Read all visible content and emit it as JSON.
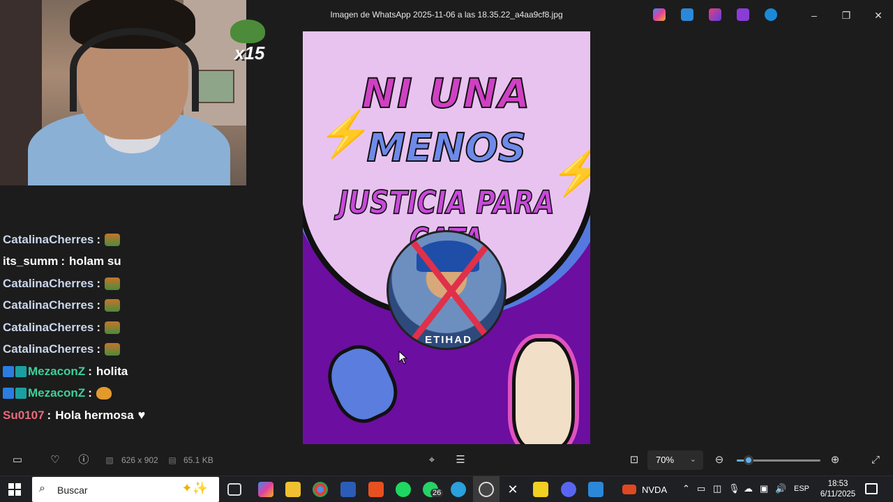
{
  "window": {
    "title": "Imagen de WhatsApp 2025-11-06 a las 18.35.22_a4aa9cf8.jpg",
    "minimize_icon": "–",
    "restore_icon": "❐",
    "close_icon": "✕"
  },
  "stream": {
    "badge_count": "x15"
  },
  "chat": {
    "messages": [
      {
        "user": "CatalinaCherres",
        "sep": ":",
        "text": "",
        "emote": "turtle-emote",
        "user_color": "#c9d6ec"
      },
      {
        "user": "its_summ",
        "sep": ":",
        "text": "holam su",
        "emote": "",
        "user_color": "#ffffff"
      },
      {
        "user": "CatalinaCherres",
        "sep": ":",
        "text": "",
        "emote": "turtle-emote",
        "user_color": "#c9d6ec"
      },
      {
        "user": "CatalinaCherres",
        "sep": ":",
        "text": "",
        "emote": "turtle-emote",
        "user_color": "#c9d6ec"
      },
      {
        "user": "CatalinaCherres",
        "sep": ":",
        "text": "",
        "emote": "turtle-emote",
        "user_color": "#c9d6ec"
      },
      {
        "user": "CatalinaCherres",
        "sep": ":",
        "text": "",
        "emote": "turtle-emote",
        "user_color": "#c9d6ec"
      },
      {
        "user": "MezaconZ",
        "sep": ":",
        "text": "holita",
        "emote": "",
        "user_color": "#3ecf9a"
      },
      {
        "user": "MezaconZ",
        "sep": ":",
        "text": "",
        "emote": "cat-emote",
        "user_color": "#3ecf9a"
      },
      {
        "user": "Su0107",
        "sep": ":",
        "text": "Hola hermosa",
        "emote": "heart",
        "user_color": "#e86a7c"
      }
    ]
  },
  "poster": {
    "line1": "NI UNA",
    "line2": "MENOS",
    "line3": "JUSTICIA PARA CATA",
    "shirt_text": "ETIHAD"
  },
  "infobar": {
    "dimensions": "626 x 902",
    "filesize": "65.1 KB",
    "zoom": "70%",
    "zoom_fraction": 0.14
  },
  "taskbar": {
    "search_placeholder": "Buscar",
    "whatsapp_badge": "26",
    "nvda_label": "NVDA",
    "language": "ESP",
    "time": "18:53",
    "date": "6/11/2025"
  },
  "colors": {
    "accent": "#60b0f0",
    "poster_purple": "#6c0ea0",
    "poster_pink": "#d040c4",
    "poster_blue": "#6f8ae8"
  }
}
